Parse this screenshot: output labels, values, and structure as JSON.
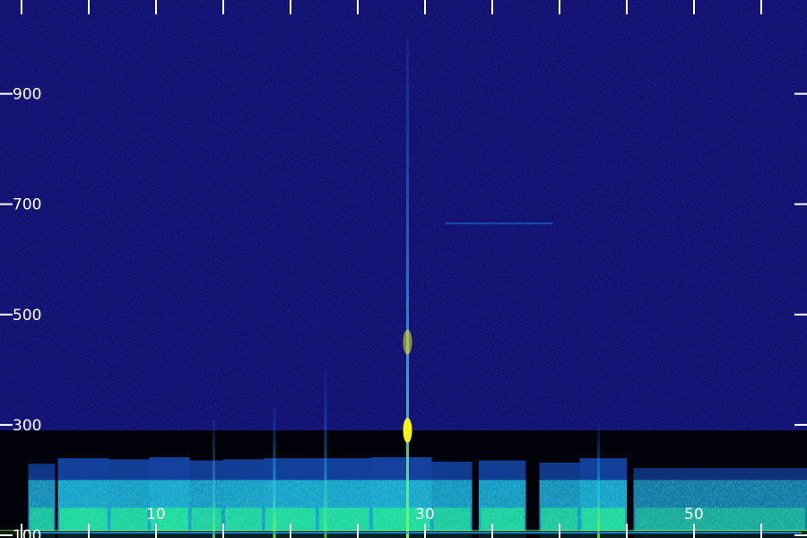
{
  "chart_data": {
    "type": "heatmap",
    "title": "",
    "xlabel": "",
    "ylabel": "",
    "y_tick_labels": [
      "100",
      "300",
      "500",
      "700",
      "900"
    ],
    "y_ticks": [
      100,
      300,
      500,
      700,
      900
    ],
    "ylim": [
      95,
      1070
    ],
    "x_tick_labels": [
      "10",
      "30",
      "50"
    ],
    "x_ticks": [
      10,
      30,
      50
    ],
    "x_minor_ticks": [
      0,
      5,
      15,
      20,
      25,
      35,
      40,
      45,
      55
    ],
    "xlim": [
      -1.6,
      58.4
    ],
    "colormap": [
      "#000000",
      "#0a0a8c",
      "#2a2aff",
      "#1f8cff",
      "#19d4e6",
      "#22f08a",
      "#7cff3a",
      "#f2f21e"
    ],
    "background_color": "#10106e",
    "energy_band_top": 290,
    "energy_regions": [
      {
        "x_start": 0.5,
        "x_end": 2.5,
        "level": 0.55
      },
      {
        "x_start": 2.7,
        "x_end": 6.5,
        "level": 0.8
      },
      {
        "x_start": 6.5,
        "x_end": 9.5,
        "level": 0.75
      },
      {
        "x_start": 9.5,
        "x_end": 12.5,
        "level": 0.85
      },
      {
        "x_start": 12.5,
        "x_end": 15.0,
        "level": 0.7
      },
      {
        "x_start": 15.0,
        "x_end": 18.0,
        "level": 0.75
      },
      {
        "x_start": 18.0,
        "x_end": 22.0,
        "level": 0.8
      },
      {
        "x_start": 22.0,
        "x_end": 26.0,
        "level": 0.8
      },
      {
        "x_start": 26.0,
        "x_end": 30.5,
        "level": 0.85
      },
      {
        "x_start": 30.5,
        "x_end": 33.5,
        "level": 0.65
      },
      {
        "x_start": 34.0,
        "x_end": 37.5,
        "level": 0.7
      },
      {
        "x_start": 38.5,
        "x_end": 41.5,
        "level": 0.6
      },
      {
        "x_start": 41.5,
        "x_end": 45.0,
        "level": 0.8
      },
      {
        "x_start": 45.5,
        "x_end": 58.4,
        "level": 0.35
      }
    ],
    "vertical_lines": [
      {
        "x": 14.3,
        "y_top": 310,
        "intensity": 0.7
      },
      {
        "x": 18.8,
        "y_top": 330,
        "intensity": 0.8
      },
      {
        "x": 22.6,
        "y_top": 400,
        "intensity": 0.6
      },
      {
        "x": 28.7,
        "y_top": 1000,
        "intensity": 1.0
      },
      {
        "x": 42.9,
        "y_top": 300,
        "intensity": 0.75
      }
    ],
    "bright_spots": [
      {
        "x": 28.7,
        "y": 290,
        "intensity": 1.0
      },
      {
        "x": 28.7,
        "y": 450,
        "intensity": 0.55
      }
    ],
    "horizontal_streaks": [
      {
        "x_start": 31.5,
        "x_end": 39.5,
        "y": 665,
        "intensity": 0.45
      },
      {
        "x_start": 0.5,
        "x_end": 58.0,
        "y": 105,
        "intensity": 0.9
      }
    ]
  }
}
